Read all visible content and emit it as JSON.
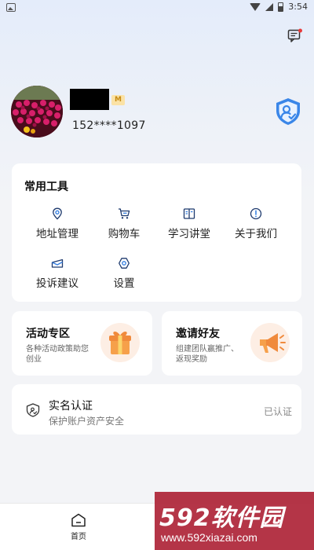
{
  "status_bar": {
    "time": "3:54"
  },
  "profile": {
    "phone": "152****1097",
    "member_badge": "M"
  },
  "tools": {
    "title": "常用工具",
    "items": [
      {
        "label": "地址管理",
        "icon": "location-pin-icon"
      },
      {
        "label": "购物车",
        "icon": "shopping-cart-icon"
      },
      {
        "label": "学习讲堂",
        "icon": "open-book-icon"
      },
      {
        "label": "关于我们",
        "icon": "info-circle-icon"
      },
      {
        "label": "投诉建议",
        "icon": "feedback-envelope-icon"
      },
      {
        "label": "设置",
        "icon": "settings-hexagon-icon"
      }
    ]
  },
  "promos": [
    {
      "title": "活动专区",
      "subtitle": "各种活动政策助您创业",
      "icon": "gift-box-icon"
    },
    {
      "title": "邀请好友",
      "subtitle": "组建团队赢推广、返现奖励",
      "icon": "megaphone-icon"
    }
  ],
  "verification": {
    "title": "实名认证",
    "subtitle": "保护账户资产安全",
    "status": "已认证"
  },
  "bottom_nav": {
    "home_label": "首页"
  },
  "watermark": {
    "brand": "592软件园",
    "url": "www.592xiazai.com"
  },
  "colors": {
    "accent_blue": "#2f7be0",
    "badge_gold": "#c68a12",
    "promo_orange": "#f08a3c",
    "watermark_red": "#aa192d"
  }
}
